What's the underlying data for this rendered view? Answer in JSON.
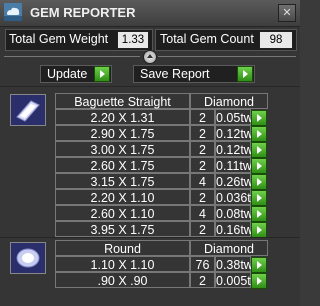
{
  "window": {
    "title": "GEM REPORTER",
    "close_symbol": "✕"
  },
  "stats": {
    "weight_label": "Total Gem Weight",
    "weight_value": "1.33",
    "count_label": "Total Gem Count",
    "count_value": "98"
  },
  "actions": {
    "update_label": "Update",
    "save_label": "Save Report"
  },
  "groups": [
    {
      "shape": "Baguette Straight",
      "material": "Diamond",
      "icon": "baguette-gem-icon",
      "rows": [
        {
          "size": "2.20 X 1.31",
          "count": "2",
          "weight": "0.05tw"
        },
        {
          "size": "2.90 X 1.75",
          "count": "2",
          "weight": "0.12tw"
        },
        {
          "size": "3.00 X 1.75",
          "count": "2",
          "weight": "0.12tw"
        },
        {
          "size": "2.60 X 1.75",
          "count": "2",
          "weight": "0.11tw"
        },
        {
          "size": "3.15 X 1.75",
          "count": "4",
          "weight": "0.26tw"
        },
        {
          "size": "2.20 X 1.10",
          "count": "2",
          "weight": "0.036tw"
        },
        {
          "size": "2.60 X 1.10",
          "count": "4",
          "weight": "0.08tw"
        },
        {
          "size": "3.95 X 1.75",
          "count": "2",
          "weight": "0.16tw"
        }
      ]
    },
    {
      "shape": "Round",
      "material": "Diamond",
      "icon": "round-gem-icon",
      "rows": [
        {
          "size": "1.10 X 1.10",
          "count": "76",
          "weight": "0.38tw"
        },
        {
          "size": ".90 X .90",
          "count": "2",
          "weight": "0.005tw"
        }
      ]
    }
  ]
}
